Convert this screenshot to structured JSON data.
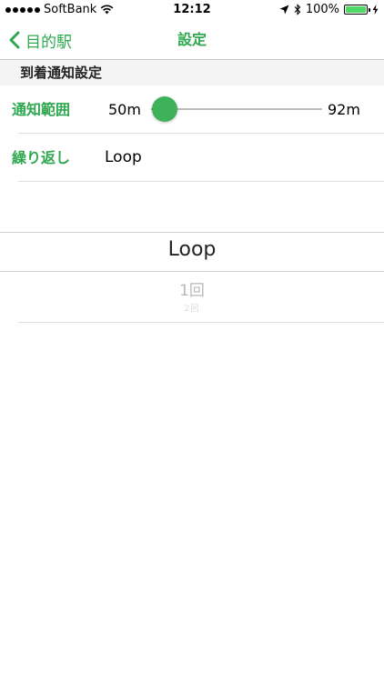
{
  "status_bar": {
    "carrier": "SoftBank",
    "time": "12:12",
    "battery": "100%"
  },
  "nav": {
    "back_label": "目的駅",
    "title": "設定"
  },
  "section": {
    "header": "到着通知設定"
  },
  "notify_range": {
    "label": "通知範囲",
    "min_label": "50m",
    "max_label": "92m",
    "value_fraction": 0.08
  },
  "repeat": {
    "label": "繰り返し",
    "value": "Loop"
  },
  "picker": {
    "selected": "Loop",
    "next": "1回",
    "next2": "2回"
  },
  "colors": {
    "accent": "#2fa84f",
    "battery": "#4cd964"
  },
  "icons": {
    "back": "chevron-left-icon",
    "wifi": "wifi-icon",
    "location": "location-arrow-icon",
    "bluetooth": "bluetooth-icon",
    "charging": "lightning-icon"
  }
}
